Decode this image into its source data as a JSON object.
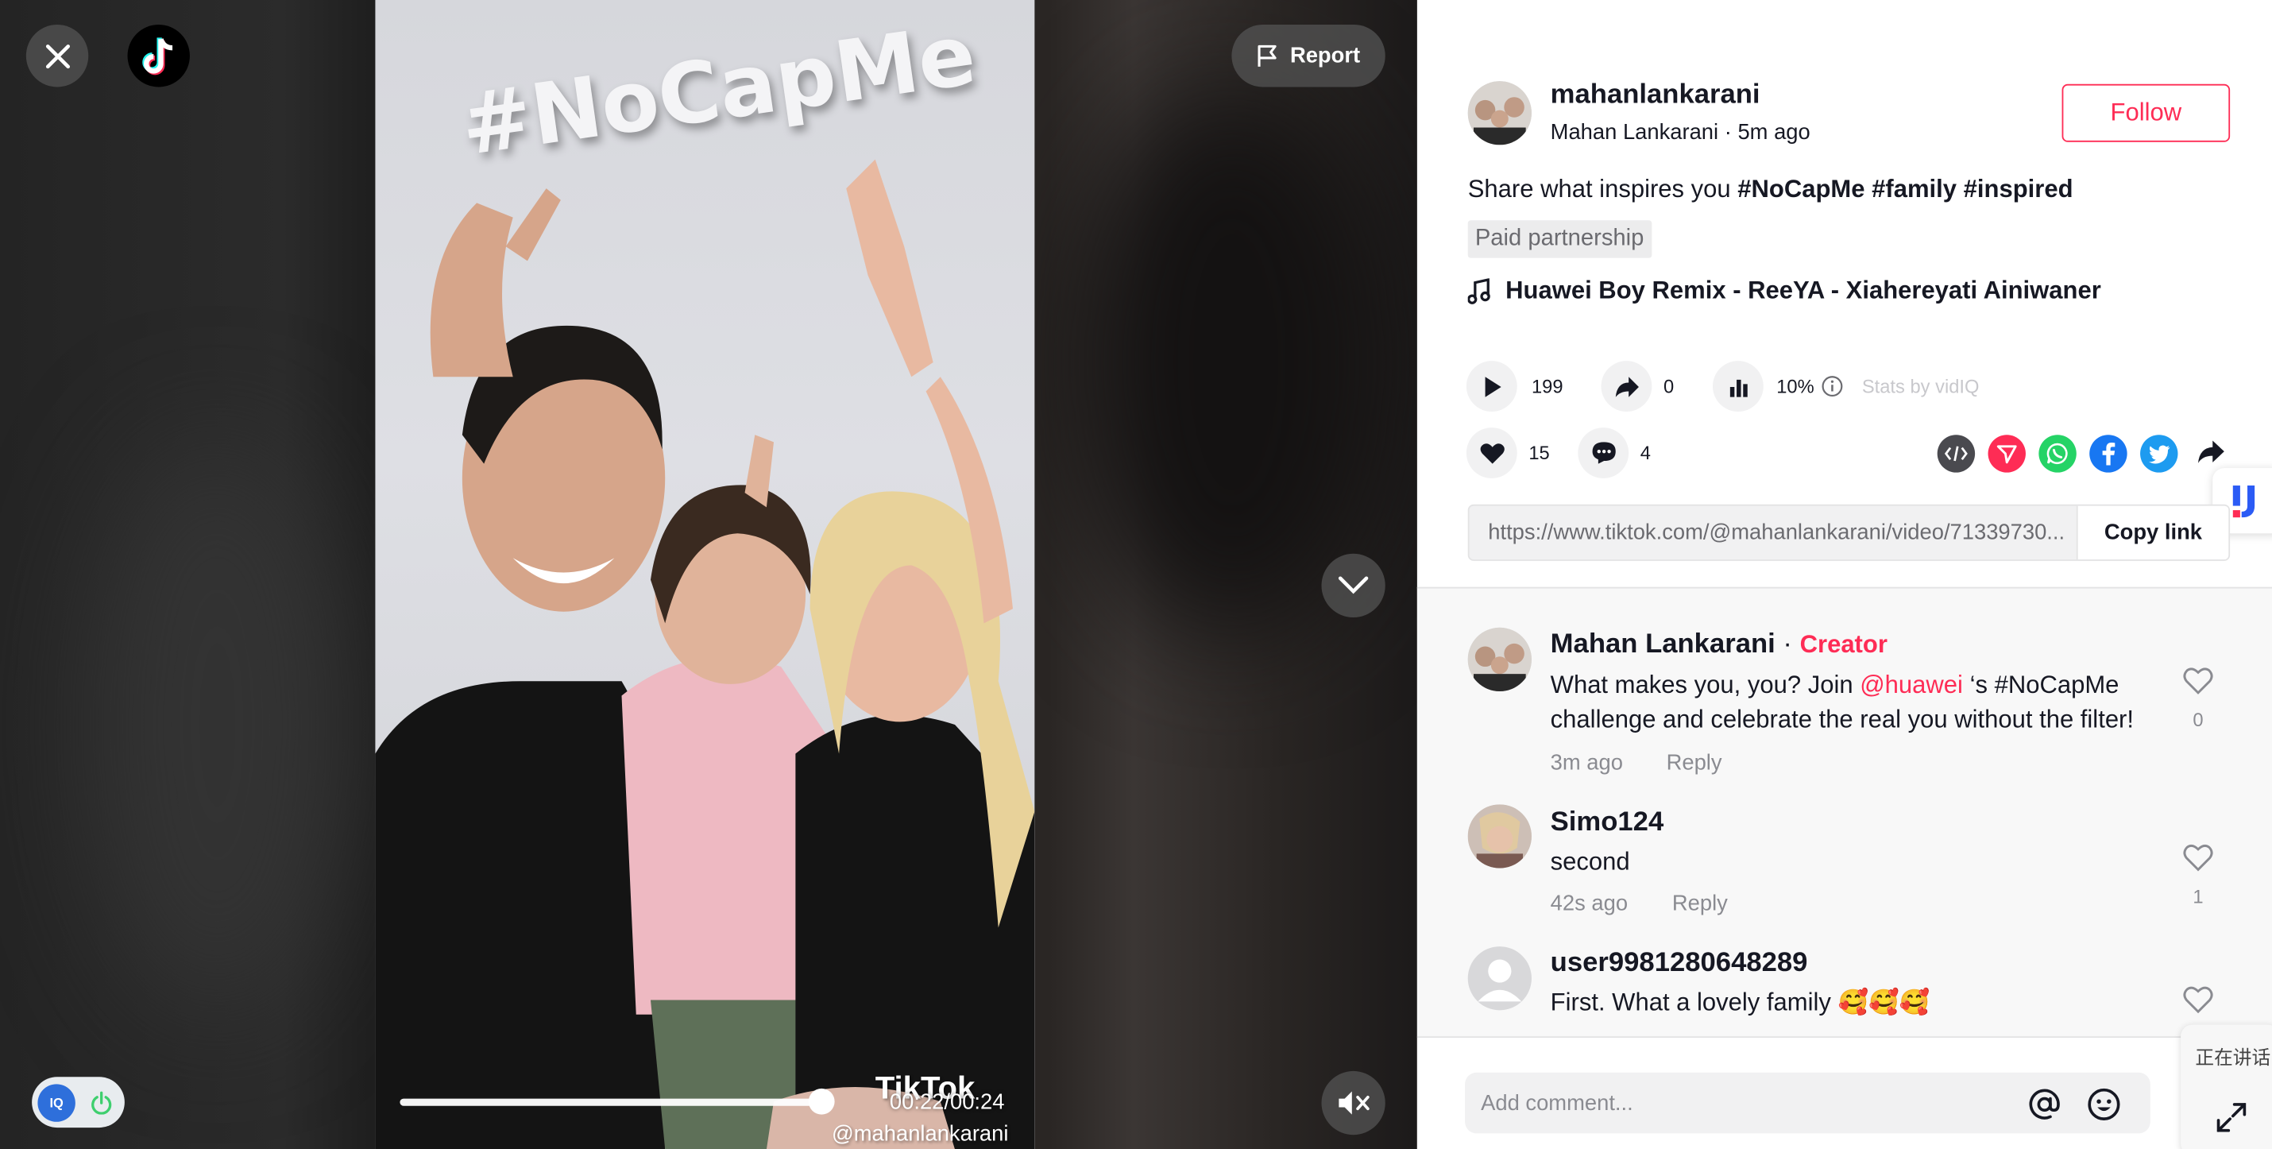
{
  "video": {
    "overlay_title": "#NoCapMe",
    "time": "00:22/00:24",
    "watermark_brand": "TikTok",
    "watermark_handle": "@mahanlankarani",
    "progress": 0.92,
    "report_label": "Report"
  },
  "author": {
    "username": "mahanlankarani",
    "display_name": "Mahan Lankarani",
    "posted": "5m ago",
    "follow_label": "Follow"
  },
  "description": {
    "text": "Share what inspires you ",
    "tags": [
      "#NoCapMe",
      "#family",
      "#inspired"
    ]
  },
  "paid_label": "Paid partnership",
  "music": "Huawei Boy Remix - ReeYA - Xiahereyati Ainiwaner",
  "stats": {
    "plays": "199",
    "shares": "0",
    "engagement": "10%",
    "stats_by": "Stats by vidIQ",
    "likes": "15",
    "comments": "4"
  },
  "link": {
    "url": "https://www.tiktok.com/@mahanlankarani/video/71339730...",
    "copy_label": "Copy link"
  },
  "comments": [
    {
      "name": "Mahan Lankarani",
      "badge": "Creator",
      "text_before": "What makes you, you? Join ",
      "mention": "@huawei",
      "text_after": " ‘s #NoCapMe challenge and celebrate the real you without the filter!",
      "time": "3m ago",
      "reply": "Reply",
      "likes": "0"
    },
    {
      "name": "Simo124",
      "text": "second",
      "time": "42s ago",
      "reply": "Reply",
      "likes": "1"
    },
    {
      "name": "user9981280648289",
      "text": "First. What a lovely family 🥰🥰🥰"
    }
  ],
  "comment_input": {
    "placeholder": "Add comment..."
  },
  "float_widget_label": "正在讲话",
  "colors": {
    "accent": "#fe2c55",
    "text": "#161823",
    "muted": "#8a8b91",
    "whatsapp": "#25d366",
    "facebook": "#1877f2",
    "twitter": "#1d9bf0",
    "telegram": "#fe2c55",
    "embed": "#4a4a4f"
  }
}
